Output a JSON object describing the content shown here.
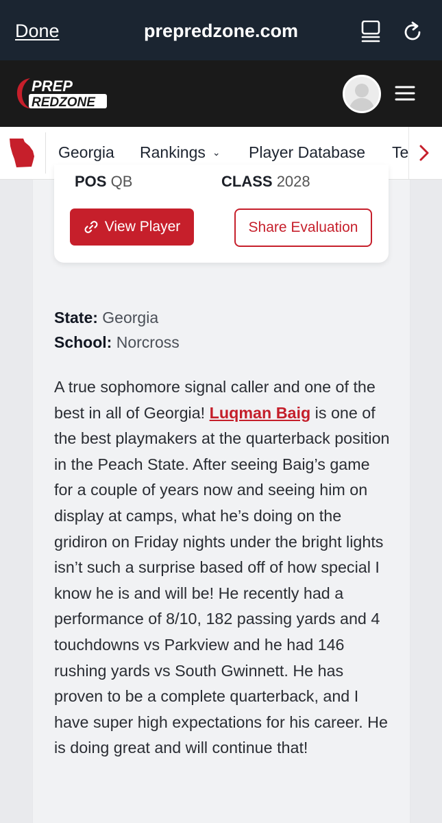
{
  "browser": {
    "done_label": "Done",
    "domain": "prepredzone.com"
  },
  "header": {
    "logo_top": "PREP",
    "logo_bottom": "REDZONE"
  },
  "nav": {
    "items": [
      {
        "label": "Georgia"
      },
      {
        "label": "Rankings"
      },
      {
        "label": "Player Database"
      },
      {
        "label": "Te"
      }
    ]
  },
  "card": {
    "pos_label": "POS",
    "pos_value": "QB",
    "class_label": "CLASS",
    "class_value": "2028",
    "view_player_label": "View Player",
    "share_label": "Share Evaluation"
  },
  "meta": {
    "state_label": "State:",
    "state_value": "Georgia",
    "school_label": "School:",
    "school_value": "Norcross"
  },
  "article": {
    "intro": "A true sophomore signal caller and one of the best in all of Georgia! ",
    "player_link": "Luqman Baig",
    "body": " is one of the best playmakers at the quarterback position in the Peach State. After seeing Baig’s game for a couple of years now and seeing him on display at camps, what he’s doing on the gridiron on Friday nights under the bright lights isn’t such a surprise based off of how special I know he is and will be! He recently had a performance of 8/10, 182 passing yards and 4 touchdowns vs Parkview and he had 146 rushing yards vs South Gwinnett. He has proven to be a complete quarterback, and I have super high expectations for his career. He is doing great and will continue that!"
  },
  "colors": {
    "brand_red": "#c61f2b",
    "browser_bar": "#1b2531",
    "site_header": "#1a1a1a"
  },
  "icons": [
    "reader-icon",
    "reload-icon",
    "menu-icon",
    "georgia-state-icon",
    "link-icon",
    "chevron-right-icon"
  ]
}
